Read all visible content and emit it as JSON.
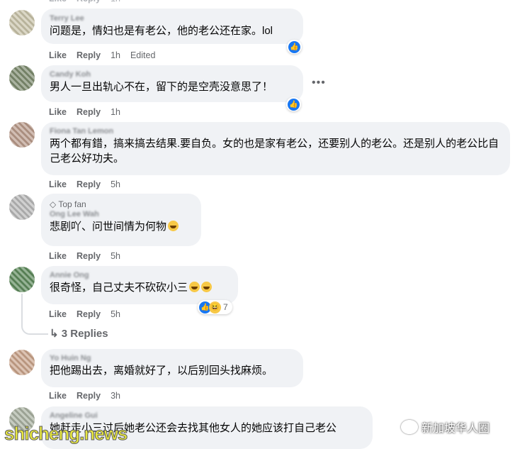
{
  "comments": [
    {
      "author": "Terry Lee",
      "text": "问题是，情妇也是有老公，他的老公还在家。lol",
      "like": "Like",
      "reply": "Reply",
      "time": "1h",
      "edited": "Edited"
    },
    {
      "author": "Candy Koh",
      "text": "男人一旦出轨心不在，留下的是空壳没意思了！",
      "like": "Like",
      "reply": "Reply",
      "time": "1h"
    },
    {
      "author": "Fiona Tan Lemon",
      "text": "两个都有錯，搞来搞去结果.要自负。女的也是家有老公，还要别人的老公。还是别人的老公比自己老公好功夫。",
      "like": "Like",
      "reply": "Reply",
      "time": "5h"
    },
    {
      "badge": "Top fan",
      "author": "Ong Lee Wah",
      "text": "悲剧吖、问世间情为何物",
      "like": "Like",
      "reply": "Reply",
      "time": "5h"
    },
    {
      "author": "Annie Ong",
      "text": "很奇怪，自己丈夫不砍砍小三",
      "like": "Like",
      "reply": "Reply",
      "time": "5h",
      "reaction_count": "7",
      "replies": "3 Replies"
    },
    {
      "author": "Yo Huin Ng",
      "text": "把他踢出去，离婚就好了，以后别回头找麻烦。",
      "like": "Like",
      "reply": "Reply",
      "time": "3h"
    },
    {
      "author": "Angeline Gui",
      "text": "她赶走小三过后她老公还会去找其他女人的她应该打自己老公"
    }
  ],
  "watermark": {
    "left": "shicheng.news",
    "right": "新加坡华人圈"
  },
  "colors": {
    "bubble": "#f0f2f5",
    "meta": "#65676b",
    "like_blue": "#1877f2",
    "watermark_yellow": "#e8e840"
  },
  "icons": {
    "like": "like-icon",
    "haha": "haha-icon",
    "more": "more-options-icon",
    "top_fan": "diamond-icon",
    "wechat": "wechat-icon"
  }
}
